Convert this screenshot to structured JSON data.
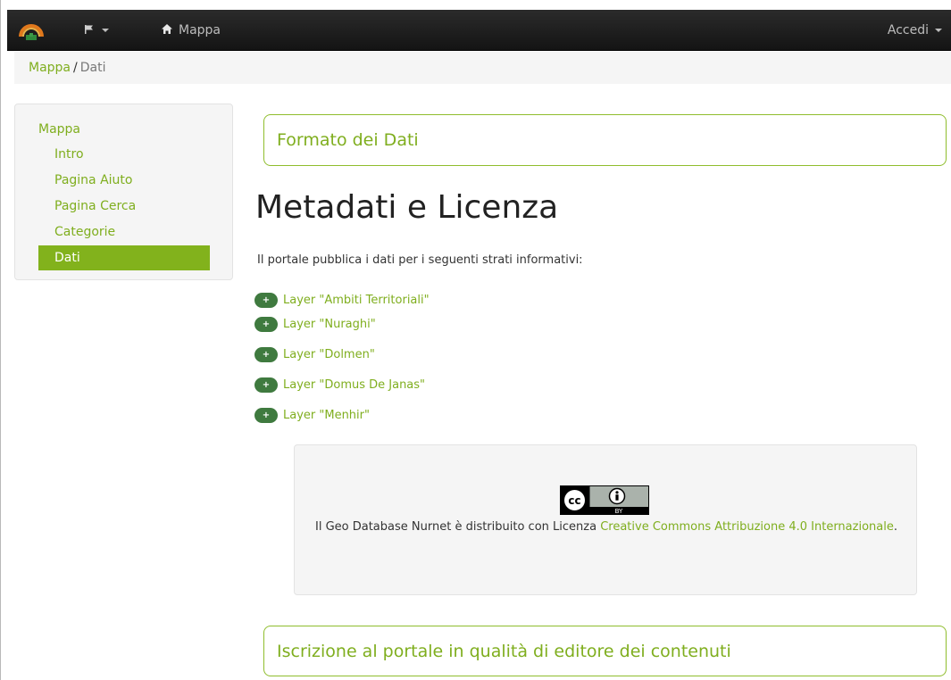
{
  "nav": {
    "home_label": "Mappa",
    "login_label": "Accedi"
  },
  "breadcrumb": {
    "parent": "Mappa",
    "separator": "/",
    "current": "Dati"
  },
  "sidebar": {
    "heading": "Mappa",
    "items": [
      {
        "label": "Intro",
        "active": false
      },
      {
        "label": "Pagina Aiuto",
        "active": false
      },
      {
        "label": "Pagina Cerca",
        "active": false
      },
      {
        "label": "Categorie",
        "active": false
      },
      {
        "label": "Dati",
        "active": true
      }
    ]
  },
  "main": {
    "section_top": "Formato dei Dati",
    "title": "Metadati e Licenza",
    "intro": "Il portale pubblica i dati per i seguenti strati informativi:",
    "layers": [
      "Layer \"Ambiti Territoriali\"",
      "Layer \"Nuraghi\"",
      "Layer \"Dolmen\"",
      "Layer \"Domus De Janas\"",
      "Layer \"Menhir\""
    ],
    "expand_symbol": "+",
    "licence": {
      "text_before": "Il Geo Database Nurnet è distribuito con Licenza ",
      "link_text": "Creative Commons Attribuzione 4.0 Internazionale",
      "text_after": ".",
      "badge_label": "BY"
    },
    "section_bottom": "Iscrizione al portale in qualità di editore dei contenuti"
  },
  "colors": {
    "accent": "#7fae1e",
    "active_bg": "#82b21c",
    "navbar": "#1e1e1e",
    "expand_pill": "#3f7a3f"
  }
}
